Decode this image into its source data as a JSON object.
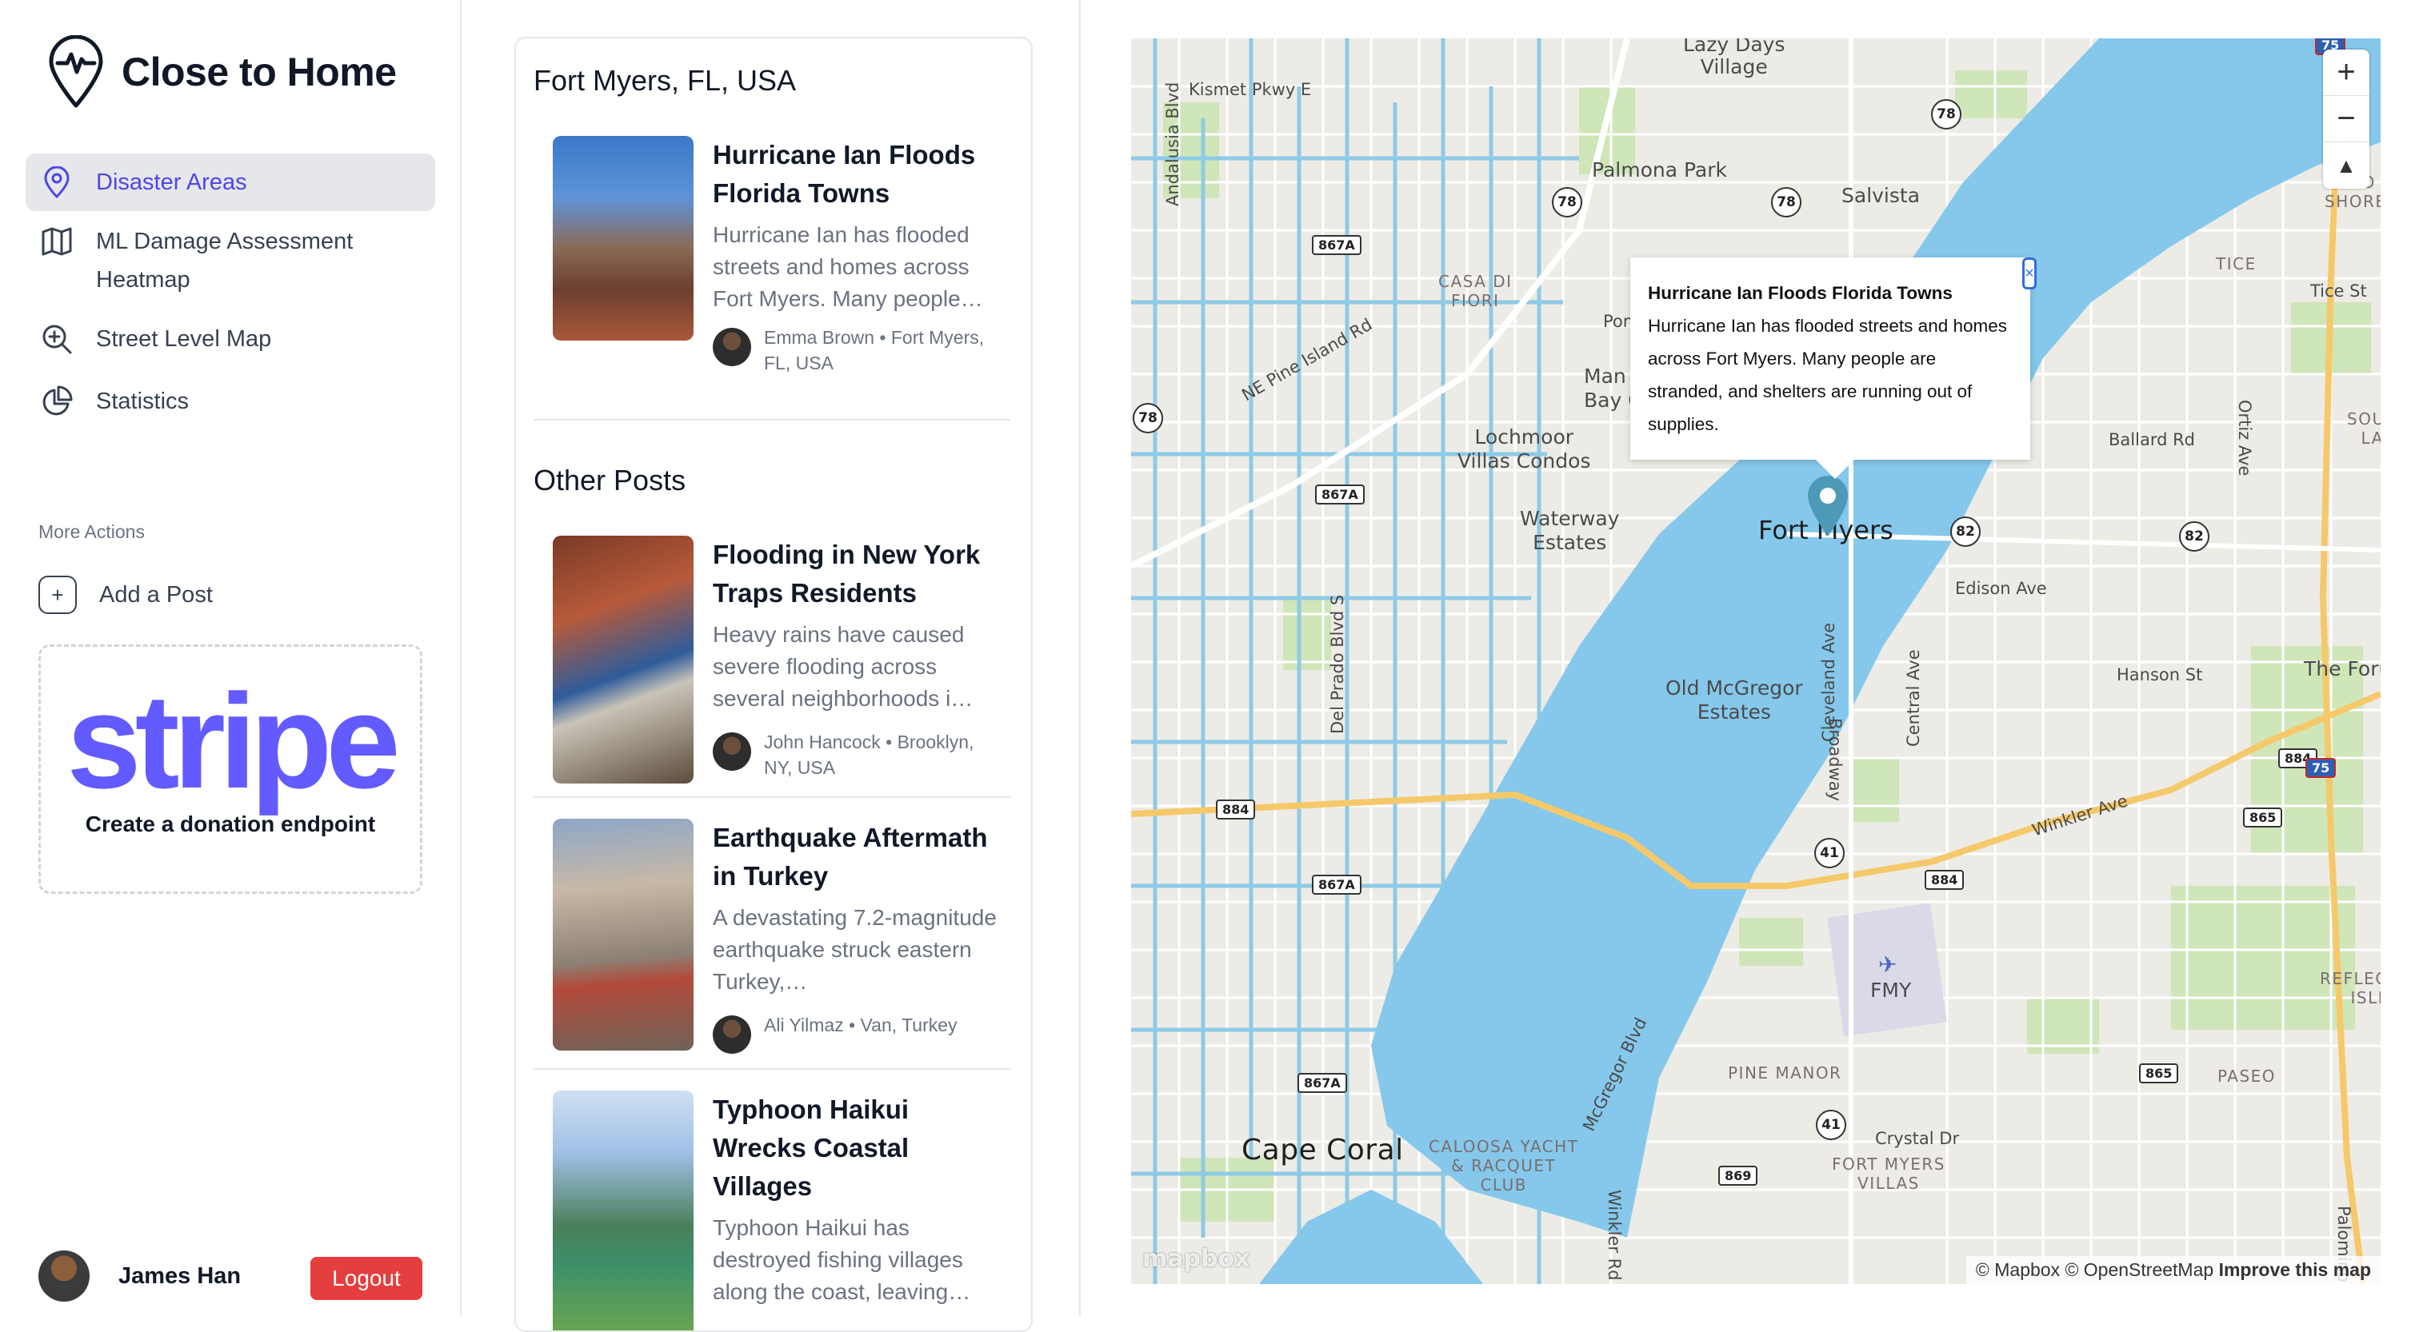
{
  "app": {
    "name": "Close to Home"
  },
  "sidebar": {
    "nav": [
      {
        "label": "Disaster Areas",
        "icon": "map-pin-icon",
        "active": true
      },
      {
        "label": "ML Damage Assessment Heatmap",
        "icon": "map-icon"
      },
      {
        "label": "Street Level Map",
        "icon": "zoom-in-icon"
      },
      {
        "label": "Statistics",
        "icon": "pie-chart-icon"
      }
    ],
    "more_actions_label": "More Actions",
    "add_post_label": "Add a Post",
    "donation": {
      "logo_text": "stripe",
      "caption": "Create a donation endpoint"
    },
    "user": {
      "name": "James Han"
    },
    "logout_label": "Logout"
  },
  "feed": {
    "location_title": "Fort Myers, FL, USA",
    "featured": {
      "title": "Hurricane Ian Floods Florida Towns",
      "excerpt": "Hurricane Ian has flooded streets and homes across Fort Myers. Many people…",
      "author_line": "Emma Brown • Fort Myers, FL, USA"
    },
    "other_title": "Other Posts",
    "others": [
      {
        "title": "Flooding in New York Traps Residents",
        "excerpt": "Heavy rains have caused severe flooding across several neighborhoods i…",
        "author_line": "John Hancock • Brooklyn, NY, USA"
      },
      {
        "title": "Earthquake Aftermath in Turkey",
        "excerpt": "A devastating 7.2-magnitude earthquake struck eastern Turkey,…",
        "author_line": "Ali Yilmaz • Van, Turkey"
      },
      {
        "title": "Typhoon Haikui Wrecks Coastal Villages",
        "excerpt": "Typhoon Haikui has destroyed fishing villages along the coast, leaving…",
        "author_line": ""
      }
    ]
  },
  "map": {
    "popup": {
      "title": "Hurricane Ian Floods Florida Towns",
      "body": "Hurricane Ian has flooded streets and homes across Fort Myers. Many people are stranded, and shelters are running out of supplies.",
      "close": "×"
    },
    "labels": {
      "fort_myers": "Fort Myers",
      "cape_coral": "Cape Coral",
      "lazy_days": "Lazy Days\nVillage",
      "kismet": "Kismet Pkwy E",
      "palmona": "Palmona Park",
      "salvista": "Salvista",
      "lochmoor": "Lochmoor\nVillas Condos",
      "waterway": "Waterway\nEstates",
      "old_mcgregor": "Old McGregor\nEstates",
      "casa_di_fiori": "CASA DI\nFIORI",
      "tice": "TICE",
      "tice_st": "Tice St",
      "ballard": "Ballard Rd",
      "edison": "Edison Ave",
      "hanson": "Hanson St",
      "the_forum": "The Foru",
      "winkler": "Winkler Ave",
      "fmy": "FMY",
      "reflection": "REFLECTION\nISLES",
      "paseo": "PASEO",
      "pine_manor": "PINE MANOR",
      "caloosa": "CALOOSA YACHT\n& RACQUET\nCLUB",
      "crystal": "Crystal Dr",
      "fort_myers_villas": "FORT MYERS\nVILLAS",
      "ne_pine": "NE Pine Island Rd",
      "andalusia": "Andalusia Blvd",
      "del_prado": "Del Prado Blvd S",
      "mcgregor_blvd": "McGregor Blvd",
      "cleveland": "Cleveland Ave",
      "broadway": "Broadway",
      "central": "Central Ave",
      "ortiz": "Ortiz Ave",
      "palomino": "Palomino Ln",
      "winkler_rd": "Winkler Rd",
      "mo_shores": "MO\nSHORES",
      "south_lak": "SOUTH\nLAK",
      "pon": "Pon",
      "manor_bay": "Man\nBay C"
    },
    "shields": [
      "78",
      "78",
      "78",
      "78",
      "82",
      "82",
      "884",
      "884",
      "884",
      "865",
      "865",
      "41",
      "41",
      "869",
      "75",
      "75"
    ],
    "county_shields": [
      "867A",
      "867A",
      "867A",
      "867A"
    ],
    "attribution": "© Mapbox © OpenStreetMap",
    "improve": "Improve this map",
    "logo": "mapbox",
    "zoom_in": "+",
    "zoom_out": "−",
    "compass": "▲"
  }
}
